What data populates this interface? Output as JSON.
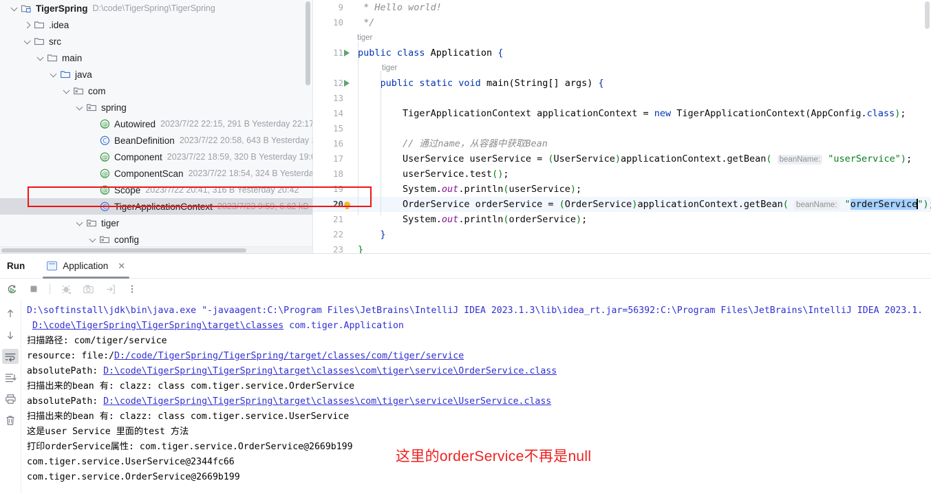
{
  "project_tree": {
    "rows": [
      {
        "indent": 0,
        "twisty": "down",
        "icon": "project-module-icon",
        "label": "TigerSpring",
        "bold": true,
        "meta": "D:\\code\\TigerSpring\\TigerSpring",
        "selected": false
      },
      {
        "indent": 1,
        "twisty": "right",
        "icon": "folder-icon",
        "label": ".idea",
        "bold": false,
        "meta": "",
        "selected": false
      },
      {
        "indent": 1,
        "twisty": "down",
        "icon": "folder-icon",
        "label": "src",
        "bold": false,
        "meta": "",
        "selected": false
      },
      {
        "indent": 2,
        "twisty": "down",
        "icon": "folder-icon",
        "label": "main",
        "bold": false,
        "meta": "",
        "selected": false
      },
      {
        "indent": 3,
        "twisty": "down",
        "icon": "source-root-icon",
        "label": "java",
        "bold": false,
        "meta": "",
        "selected": false
      },
      {
        "indent": 4,
        "twisty": "down",
        "icon": "package-icon",
        "label": "com",
        "bold": false,
        "meta": "",
        "selected": false
      },
      {
        "indent": 5,
        "twisty": "down",
        "icon": "package-icon",
        "label": "spring",
        "bold": false,
        "meta": "",
        "selected": false
      },
      {
        "indent": 6,
        "twisty": "none",
        "icon": "annotation-icon",
        "label": "Autowired",
        "bold": false,
        "meta": "2023/7/22 22:15, 291 B Yesterday 22:17",
        "selected": false
      },
      {
        "indent": 6,
        "twisty": "none",
        "icon": "class-icon",
        "label": "BeanDefinition",
        "bold": false,
        "meta": "2023/7/22 20:58, 643 B Yesterday 2",
        "selected": false
      },
      {
        "indent": 6,
        "twisty": "none",
        "icon": "annotation-icon",
        "label": "Component",
        "bold": false,
        "meta": "2023/7/22 18:59, 320 B Yesterday 19:0",
        "selected": false
      },
      {
        "indent": 6,
        "twisty": "none",
        "icon": "annotation-icon",
        "label": "ComponentScan",
        "bold": false,
        "meta": "2023/7/22 18:54, 324 B Yesterday",
        "selected": false
      },
      {
        "indent": 6,
        "twisty": "none",
        "icon": "annotation-icon",
        "label": "Scope",
        "bold": false,
        "meta": "2023/7/22 20:41, 316 B Yesterday 20:42",
        "selected": false
      },
      {
        "indent": 6,
        "twisty": "none",
        "icon": "class-icon",
        "label": "TigerApplicationContext",
        "bold": false,
        "meta": "2023/7/23 9:59, 6.62 kB",
        "selected": true
      },
      {
        "indent": 5,
        "twisty": "down",
        "icon": "package-icon",
        "label": "tiger",
        "bold": false,
        "meta": "",
        "selected": false
      },
      {
        "indent": 6,
        "twisty": "down",
        "icon": "package-icon",
        "label": "config",
        "bold": false,
        "meta": "",
        "selected": false
      }
    ]
  },
  "editor": {
    "lines": [
      {
        "num": "9",
        "type": "code",
        "gutter": "",
        "current": false,
        "segs": [
          {
            "t": " * Hello world!",
            "c": "cmt"
          }
        ]
      },
      {
        "num": "10",
        "type": "code",
        "gutter": "",
        "current": false,
        "segs": [
          {
            "t": " */",
            "c": "cmt"
          }
        ]
      },
      {
        "num": "",
        "type": "hint",
        "indent": 44,
        "text": "tiger"
      },
      {
        "num": "11",
        "type": "code",
        "gutter": "run",
        "current": false,
        "segs": [
          {
            "t": "public class ",
            "c": "kw"
          },
          {
            "t": "Application ",
            "c": "cls"
          },
          {
            "t": "{",
            "c": "brace1"
          }
        ]
      },
      {
        "num": "",
        "type": "hint",
        "indent": 80,
        "text": "tiger"
      },
      {
        "num": "12",
        "type": "code",
        "gutter": "run",
        "current": false,
        "segs": [
          {
            "t": "    ",
            "c": ""
          },
          {
            "t": "public static void ",
            "c": "kw"
          },
          {
            "t": "main(String[] args) ",
            "c": "cls"
          },
          {
            "t": "{",
            "c": "brace1"
          }
        ]
      },
      {
        "num": "13",
        "type": "code",
        "gutter": "",
        "current": false,
        "segs": []
      },
      {
        "num": "14",
        "type": "code",
        "gutter": "",
        "current": false,
        "segs": [
          {
            "t": "        TigerApplicationContext applicationContext = ",
            "c": ""
          },
          {
            "t": "new ",
            "c": "kw"
          },
          {
            "t": "TigerApplicationContext(AppConfig.",
            "c": ""
          },
          {
            "t": "class",
            "c": "kw"
          },
          {
            "t": ")",
            "c": "punc-g"
          },
          {
            "t": ";",
            "c": ""
          }
        ]
      },
      {
        "num": "15",
        "type": "code",
        "gutter": "",
        "current": false,
        "segs": []
      },
      {
        "num": "16",
        "type": "code",
        "gutter": "",
        "current": false,
        "segs": [
          {
            "t": "        // 通过name，从容器中获取Bean",
            "c": "cmt"
          }
        ]
      },
      {
        "num": "17",
        "type": "code",
        "gutter": "",
        "current": false,
        "segs": [
          {
            "t": "        UserService userService = ",
            "c": ""
          },
          {
            "t": "(",
            "c": "punc-g"
          },
          {
            "t": "UserService",
            "c": ""
          },
          {
            "t": ")",
            "c": "punc-g"
          },
          {
            "t": "applicationContext.getBean",
            "c": ""
          },
          {
            "t": "(",
            "c": "punc-g"
          },
          {
            "t": " ",
            "c": ""
          },
          {
            "t": "beanName:",
            "c": "hint"
          },
          {
            "t": " ",
            "c": ""
          },
          {
            "t": "\"userService\"",
            "c": "str"
          },
          {
            "t": ")",
            "c": "punc-g"
          },
          {
            "t": ";",
            "c": ""
          }
        ]
      },
      {
        "num": "18",
        "type": "code",
        "gutter": "",
        "current": false,
        "segs": [
          {
            "t": "        userService.test",
            "c": ""
          },
          {
            "t": "()",
            "c": "punc-g"
          },
          {
            "t": ";",
            "c": ""
          }
        ]
      },
      {
        "num": "19",
        "type": "code",
        "gutter": "",
        "current": false,
        "segs": [
          {
            "t": "        System.",
            "c": ""
          },
          {
            "t": "out",
            "c": "fld"
          },
          {
            "t": ".println",
            "c": ""
          },
          {
            "t": "(",
            "c": "punc-g"
          },
          {
            "t": "userService",
            "c": ""
          },
          {
            "t": ")",
            "c": "punc-g"
          },
          {
            "t": ";",
            "c": ""
          }
        ]
      },
      {
        "num": "20",
        "type": "code",
        "gutter": "bulb",
        "current": true,
        "segs": [
          {
            "t": "        OrderService orderService = ",
            "c": ""
          },
          {
            "t": "(",
            "c": "punc-g"
          },
          {
            "t": "OrderService",
            "c": ""
          },
          {
            "t": ")",
            "c": "punc-g"
          },
          {
            "t": "applicationContext.getBean",
            "c": ""
          },
          {
            "t": "(",
            "c": "punc-g"
          },
          {
            "t": " ",
            "c": ""
          },
          {
            "t": "beanName:",
            "c": "hint"
          },
          {
            "t": " ",
            "c": ""
          },
          {
            "t": "\"",
            "c": "str"
          },
          {
            "t": "orderService",
            "c": "sel"
          },
          {
            "t": "\"",
            "c": "str"
          },
          {
            "t": ")",
            "c": "punc-g"
          },
          {
            "t": ";",
            "c": ""
          }
        ]
      },
      {
        "num": "21",
        "type": "code",
        "gutter": "",
        "current": false,
        "segs": [
          {
            "t": "        System.",
            "c": ""
          },
          {
            "t": "out",
            "c": "fld"
          },
          {
            "t": ".println",
            "c": ""
          },
          {
            "t": "(",
            "c": "punc-g"
          },
          {
            "t": "orderService",
            "c": ""
          },
          {
            "t": ")",
            "c": "punc-g"
          },
          {
            "t": ";",
            "c": ""
          }
        ]
      },
      {
        "num": "22",
        "type": "code",
        "gutter": "",
        "current": false,
        "segs": [
          {
            "t": "    }",
            "c": "brace1"
          }
        ]
      },
      {
        "num": "23",
        "type": "code",
        "gutter": "",
        "current": false,
        "segs": [
          {
            "t": "}",
            "c": "punc-g"
          }
        ]
      }
    ]
  },
  "run_panel": {
    "title": "Run",
    "tab_label": "Application",
    "tab_close": "✕",
    "toolbar": [
      {
        "name": "rerun-button",
        "icon": "rerun-icon",
        "disabled": false
      },
      {
        "name": "stop-button",
        "icon": "stop-icon",
        "disabled": false
      },
      {
        "name": "debug-button",
        "icon": "debug-icon",
        "disabled": true
      },
      {
        "name": "camera-button",
        "icon": "camera-icon",
        "disabled": true
      },
      {
        "name": "export-button",
        "icon": "export-icon",
        "disabled": true
      },
      {
        "name": "more-button",
        "icon": "more-vertical-icon",
        "disabled": false
      }
    ],
    "gutter_buttons": [
      {
        "name": "scroll-up-button",
        "icon": "arrow-up-icon",
        "active": false
      },
      {
        "name": "scroll-down-button",
        "icon": "arrow-down-icon",
        "active": false
      },
      {
        "name": "soft-wrap-button",
        "icon": "soft-wrap-icon",
        "active": true
      },
      {
        "name": "scroll-to-end-button",
        "icon": "scroll-to-end-icon",
        "active": false
      },
      {
        "name": "print-button",
        "icon": "print-icon",
        "active": false
      },
      {
        "name": "clear-all-button",
        "icon": "trash-icon",
        "active": false
      }
    ],
    "console": [
      {
        "segs": [
          {
            "t": "D:\\softinstall\\jdk\\bin\\java.exe \"-javaagent:C:\\Program Files\\JetBrains\\IntelliJ IDEA 2023.1.3\\lib\\idea_rt.jar=56392:C:\\Program Files\\JetBrains\\IntelliJ IDEA 2023.1.",
            "c": "sys"
          }
        ]
      },
      {
        "segs": [
          {
            "t": " ",
            "c": "sys"
          },
          {
            "t": "D:\\code\\TigerSpring\\TigerSpring\\target\\classes",
            "c": "link"
          },
          {
            "t": " com.tiger.Application",
            "c": "sys"
          }
        ]
      },
      {
        "segs": [
          {
            "t": "扫描路径: com/tiger/service",
            "c": "out"
          }
        ]
      },
      {
        "segs": [
          {
            "t": "resource: file:/",
            "c": "out"
          },
          {
            "t": "D:/code/TigerSpring/TigerSpring/target/classes/com/tiger/service",
            "c": "link"
          }
        ]
      },
      {
        "segs": [
          {
            "t": "absolutePath: ",
            "c": "out"
          },
          {
            "t": "D:\\code\\TigerSpring\\TigerSpring\\target\\classes\\com\\tiger\\service\\OrderService.class",
            "c": "link"
          }
        ]
      },
      {
        "segs": [
          {
            "t": "扫描出来的bean 有: clazz: class com.tiger.service.OrderService",
            "c": "out"
          }
        ]
      },
      {
        "segs": [
          {
            "t": "absolutePath: ",
            "c": "out"
          },
          {
            "t": "D:\\code\\TigerSpring\\TigerSpring\\target\\classes\\com\\tiger\\service\\UserService.class",
            "c": "link"
          }
        ]
      },
      {
        "segs": [
          {
            "t": "扫描出来的bean 有: clazz: class com.tiger.service.UserService",
            "c": "out"
          }
        ]
      },
      {
        "segs": [
          {
            "t": "这是user Service 里面的test 方法",
            "c": "out"
          }
        ]
      },
      {
        "segs": [
          {
            "t": "打印orderService属性: com.tiger.service.OrderService@2669b199",
            "c": "out"
          }
        ]
      },
      {
        "segs": [
          {
            "t": "com.tiger.service.UserService@2344fc66",
            "c": "out"
          }
        ]
      },
      {
        "segs": [
          {
            "t": "com.tiger.service.OrderService@2669b199",
            "c": "out"
          }
        ]
      }
    ]
  },
  "annotation": {
    "text": "这里的orderService不再是null",
    "color": "#ef2020"
  }
}
